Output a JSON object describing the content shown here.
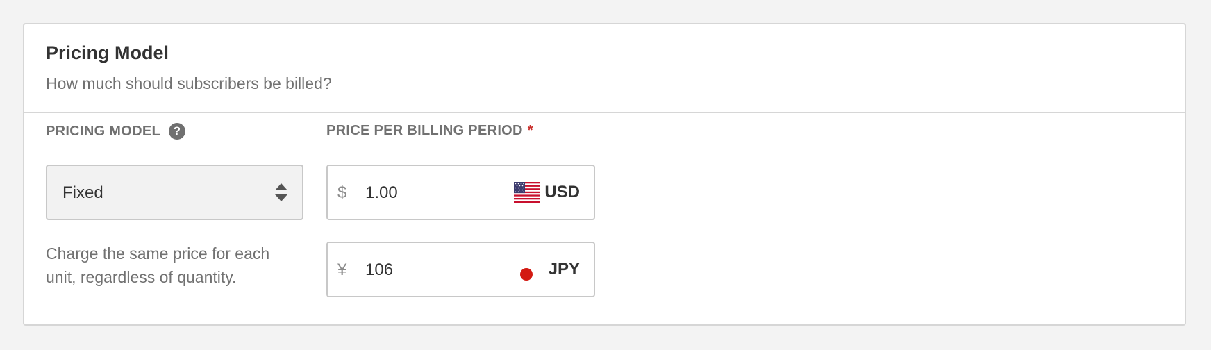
{
  "card": {
    "title": "Pricing Model",
    "subtitle": "How much should subscribers be billed?"
  },
  "pricing_model_field": {
    "label": "PRICING MODEL",
    "help_icon": "question-circle-icon",
    "help_glyph": "?",
    "selected_value": "Fixed",
    "description": "Charge the same price for each unit, regardless of quantity."
  },
  "price_field": {
    "label": "PRICE PER BILLING PERIOD",
    "required_mark": "*",
    "required_color": "#c9302c",
    "prices": [
      {
        "symbol": "$",
        "amount": "1.00",
        "currency": "USD",
        "flag_icon": "us-flag-icon"
      },
      {
        "symbol": "¥",
        "amount": "106",
        "currency": "JPY",
        "flag_icon": "jp-flag-icon"
      }
    ]
  }
}
